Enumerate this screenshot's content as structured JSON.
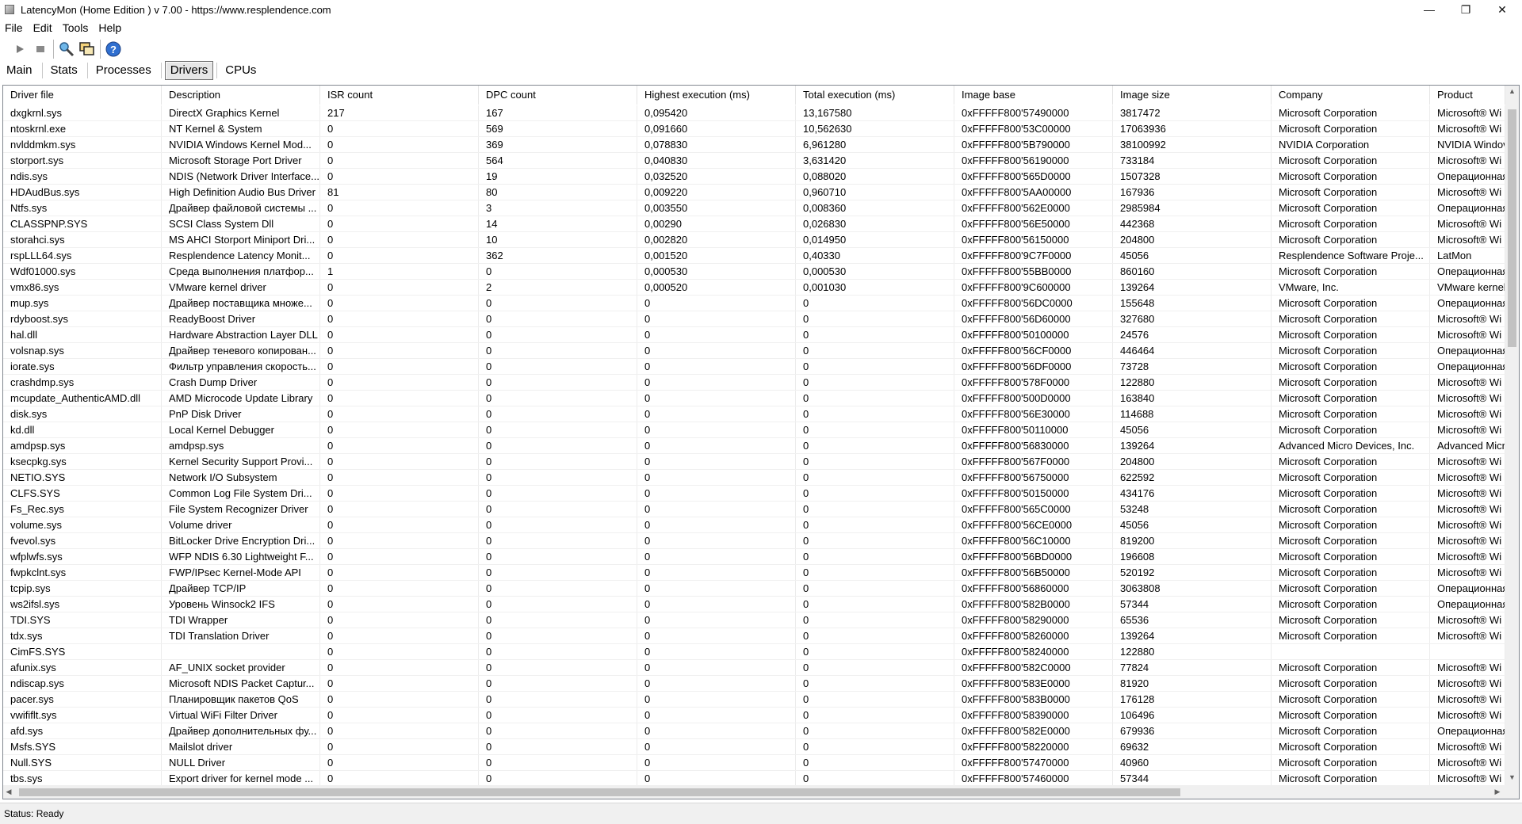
{
  "window": {
    "title": "LatencyMon  (Home Edition )  v 7.00 - https://www.resplendence.com",
    "minimize_glyph": "—",
    "maximize_glyph": "❐",
    "close_glyph": "✕"
  },
  "menu": {
    "file": "File",
    "edit": "Edit",
    "tools": "Tools",
    "help": "Help"
  },
  "toolbar": {
    "icons": [
      "play-icon",
      "stop-icon",
      "search-tool-icon",
      "windows-icon",
      "help-icon"
    ]
  },
  "tabs": {
    "main": "Main",
    "stats": "Stats",
    "processes": "Processes",
    "drivers": "Drivers",
    "cpus": "CPUs",
    "active": "Drivers"
  },
  "table": {
    "columns": [
      "Driver file",
      "Description",
      "ISR count",
      "DPC count",
      "Highest execution (ms)",
      "Total execution (ms)",
      "Image base",
      "Image size",
      "Company",
      "Product"
    ],
    "rows": [
      [
        "dxgkrnl.sys",
        "DirectX Graphics Kernel",
        "217",
        "167",
        "0,095420",
        "13,167580",
        "0xFFFFF800'57490000",
        "3817472",
        "Microsoft Corporation",
        "Microsoft® Wi"
      ],
      [
        "ntoskrnl.exe",
        "NT Kernel & System",
        "0",
        "569",
        "0,091660",
        "10,562630",
        "0xFFFFF800'53C00000",
        "17063936",
        "Microsoft Corporation",
        "Microsoft® Wi"
      ],
      [
        "nvlddmkm.sys",
        "NVIDIA Windows Kernel Mod...",
        "0",
        "369",
        "0,078830",
        "6,961280",
        "0xFFFFF800'5B790000",
        "38100992",
        "NVIDIA Corporation",
        "NVIDIA Windov"
      ],
      [
        "storport.sys",
        "Microsoft Storage Port Driver",
        "0",
        "564",
        "0,040830",
        "3,631420",
        "0xFFFFF800'56190000",
        "733184",
        "Microsoft Corporation",
        "Microsoft® Wi"
      ],
      [
        "ndis.sys",
        "NDIS (Network Driver Interface...",
        "0",
        "19",
        "0,032520",
        "0,088020",
        "0xFFFFF800'565D0000",
        "1507328",
        "Microsoft Corporation",
        "Операционная"
      ],
      [
        "HDAudBus.sys",
        "High Definition Audio Bus Driver",
        "81",
        "80",
        "0,009220",
        "0,960710",
        "0xFFFFF800'5AA00000",
        "167936",
        "Microsoft Corporation",
        "Microsoft® Wi"
      ],
      [
        "Ntfs.sys",
        "Драйвер файловой системы ...",
        "0",
        "3",
        "0,003550",
        "0,008360",
        "0xFFFFF800'562E0000",
        "2985984",
        "Microsoft Corporation",
        "Операционная"
      ],
      [
        "CLASSPNP.SYS",
        "SCSI Class System Dll",
        "0",
        "14",
        "0,00290",
        "0,026830",
        "0xFFFFF800'56E50000",
        "442368",
        "Microsoft Corporation",
        "Microsoft® Wi"
      ],
      [
        "storahci.sys",
        "MS AHCI Storport Miniport Dri...",
        "0",
        "10",
        "0,002820",
        "0,014950",
        "0xFFFFF800'56150000",
        "204800",
        "Microsoft Corporation",
        "Microsoft® Wi"
      ],
      [
        "rspLLL64.sys",
        "Resplendence Latency Monit...",
        "0",
        "362",
        "0,001520",
        "0,40330",
        "0xFFFFF800'9C7F0000",
        "45056",
        "Resplendence Software Proje...",
        "LatMon"
      ],
      [
        "Wdf01000.sys",
        "Среда выполнения платфор...",
        "1",
        "0",
        "0,000530",
        "0,000530",
        "0xFFFFF800'55BB0000",
        "860160",
        "Microsoft Corporation",
        "Операционная"
      ],
      [
        "vmx86.sys",
        "VMware kernel driver",
        "0",
        "2",
        "0,000520",
        "0,001030",
        "0xFFFFF800'9C600000",
        "139264",
        "VMware, Inc.",
        "VMware kernel"
      ],
      [
        "mup.sys",
        "Драйвер поставщика множе...",
        "0",
        "0",
        "0",
        "0",
        "0xFFFFF800'56DC0000",
        "155648",
        "Microsoft Corporation",
        "Операционная"
      ],
      [
        "rdyboost.sys",
        "ReadyBoost Driver",
        "0",
        "0",
        "0",
        "0",
        "0xFFFFF800'56D60000",
        "327680",
        "Microsoft Corporation",
        "Microsoft® Wi"
      ],
      [
        "hal.dll",
        "Hardware Abstraction Layer DLL",
        "0",
        "0",
        "0",
        "0",
        "0xFFFFF800'50100000",
        "24576",
        "Microsoft Corporation",
        "Microsoft® Wi"
      ],
      [
        "volsnap.sys",
        "Драйвер теневого копирован...",
        "0",
        "0",
        "0",
        "0",
        "0xFFFFF800'56CF0000",
        "446464",
        "Microsoft Corporation",
        "Операционная"
      ],
      [
        "iorate.sys",
        "Фильтр управления скорость...",
        "0",
        "0",
        "0",
        "0",
        "0xFFFFF800'56DF0000",
        "73728",
        "Microsoft Corporation",
        "Операционная"
      ],
      [
        "crashdmp.sys",
        "Crash Dump Driver",
        "0",
        "0",
        "0",
        "0",
        "0xFFFFF800'578F0000",
        "122880",
        "Microsoft Corporation",
        "Microsoft® Wi"
      ],
      [
        "mcupdate_AuthenticAMD.dll",
        "AMD Microcode Update Library",
        "0",
        "0",
        "0",
        "0",
        "0xFFFFF800'500D0000",
        "163840",
        "Microsoft Corporation",
        "Microsoft® Wi"
      ],
      [
        "disk.sys",
        "PnP Disk Driver",
        "0",
        "0",
        "0",
        "0",
        "0xFFFFF800'56E30000",
        "114688",
        "Microsoft Corporation",
        "Microsoft® Wi"
      ],
      [
        "kd.dll",
        "Local Kernel Debugger",
        "0",
        "0",
        "0",
        "0",
        "0xFFFFF800'50110000",
        "45056",
        "Microsoft Corporation",
        "Microsoft® Wi"
      ],
      [
        "amdpsp.sys",
        "amdpsp.sys",
        "0",
        "0",
        "0",
        "0",
        "0xFFFFF800'56830000",
        "139264",
        "Advanced Micro Devices, Inc.",
        "Advanced Micr"
      ],
      [
        "ksecpkg.sys",
        "Kernel Security Support Provi...",
        "0",
        "0",
        "0",
        "0",
        "0xFFFFF800'567F0000",
        "204800",
        "Microsoft Corporation",
        "Microsoft® Wi"
      ],
      [
        "NETIO.SYS",
        "Network I/O Subsystem",
        "0",
        "0",
        "0",
        "0",
        "0xFFFFF800'56750000",
        "622592",
        "Microsoft Corporation",
        "Microsoft® Wi"
      ],
      [
        "CLFS.SYS",
        "Common Log File System Dri...",
        "0",
        "0",
        "0",
        "0",
        "0xFFFFF800'50150000",
        "434176",
        "Microsoft Corporation",
        "Microsoft® Wi"
      ],
      [
        "Fs_Rec.sys",
        "File System Recognizer Driver",
        "0",
        "0",
        "0",
        "0",
        "0xFFFFF800'565C0000",
        "53248",
        "Microsoft Corporation",
        "Microsoft® Wi"
      ],
      [
        "volume.sys",
        "Volume driver",
        "0",
        "0",
        "0",
        "0",
        "0xFFFFF800'56CE0000",
        "45056",
        "Microsoft Corporation",
        "Microsoft® Wi"
      ],
      [
        "fvevol.sys",
        "BitLocker Drive Encryption Dri...",
        "0",
        "0",
        "0",
        "0",
        "0xFFFFF800'56C10000",
        "819200",
        "Microsoft Corporation",
        "Microsoft® Wi"
      ],
      [
        "wfplwfs.sys",
        "WFP NDIS 6.30 Lightweight F...",
        "0",
        "0",
        "0",
        "0",
        "0xFFFFF800'56BD0000",
        "196608",
        "Microsoft Corporation",
        "Microsoft® Wi"
      ],
      [
        "fwpkclnt.sys",
        "FWP/IPsec Kernel-Mode API",
        "0",
        "0",
        "0",
        "0",
        "0xFFFFF800'56B50000",
        "520192",
        "Microsoft Corporation",
        "Microsoft® Wi"
      ],
      [
        "tcpip.sys",
        "Драйвер TCP/IP",
        "0",
        "0",
        "0",
        "0",
        "0xFFFFF800'56860000",
        "3063808",
        "Microsoft Corporation",
        "Операционная"
      ],
      [
        "ws2ifsl.sys",
        "Уровень Winsock2 IFS",
        "0",
        "0",
        "0",
        "0",
        "0xFFFFF800'582B0000",
        "57344",
        "Microsoft Corporation",
        "Операционная"
      ],
      [
        "TDI.SYS",
        "TDI Wrapper",
        "0",
        "0",
        "0",
        "0",
        "0xFFFFF800'58290000",
        "65536",
        "Microsoft Corporation",
        "Microsoft® Wi"
      ],
      [
        "tdx.sys",
        "TDI Translation Driver",
        "0",
        "0",
        "0",
        "0",
        "0xFFFFF800'58260000",
        "139264",
        "Microsoft Corporation",
        "Microsoft® Wi"
      ],
      [
        "CimFS.SYS",
        "",
        "0",
        "0",
        "0",
        "0",
        "0xFFFFF800'58240000",
        "122880",
        "",
        ""
      ],
      [
        "afunix.sys",
        "AF_UNIX socket provider",
        "0",
        "0",
        "0",
        "0",
        "0xFFFFF800'582C0000",
        "77824",
        "Microsoft Corporation",
        "Microsoft® Wi"
      ],
      [
        "ndiscap.sys",
        "Microsoft NDIS Packet Captur...",
        "0",
        "0",
        "0",
        "0",
        "0xFFFFF800'583E0000",
        "81920",
        "Microsoft Corporation",
        "Microsoft® Wi"
      ],
      [
        "pacer.sys",
        "Планировщик пакетов QoS",
        "0",
        "0",
        "0",
        "0",
        "0xFFFFF800'583B0000",
        "176128",
        "Microsoft Corporation",
        "Microsoft® Wi"
      ],
      [
        "vwififlt.sys",
        "Virtual WiFi Filter Driver",
        "0",
        "0",
        "0",
        "0",
        "0xFFFFF800'58390000",
        "106496",
        "Microsoft Corporation",
        "Microsoft® Wi"
      ],
      [
        "afd.sys",
        "Драйвер дополнительных фу...",
        "0",
        "0",
        "0",
        "0",
        "0xFFFFF800'582E0000",
        "679936",
        "Microsoft Corporation",
        "Операционная"
      ],
      [
        "Msfs.SYS",
        "Mailslot driver",
        "0",
        "0",
        "0",
        "0",
        "0xFFFFF800'58220000",
        "69632",
        "Microsoft Corporation",
        "Microsoft® Wi"
      ],
      [
        "Null.SYS",
        "NULL Driver",
        "0",
        "0",
        "0",
        "0",
        "0xFFFFF800'57470000",
        "40960",
        "Microsoft Corporation",
        "Microsoft® Wi"
      ],
      [
        "tbs.sys",
        "Export driver for kernel mode ...",
        "0",
        "0",
        "0",
        "0",
        "0xFFFFF800'57460000",
        "57344",
        "Microsoft Corporation",
        "Microsoft® Wi"
      ]
    ]
  },
  "status": {
    "text": "Status: Ready"
  }
}
